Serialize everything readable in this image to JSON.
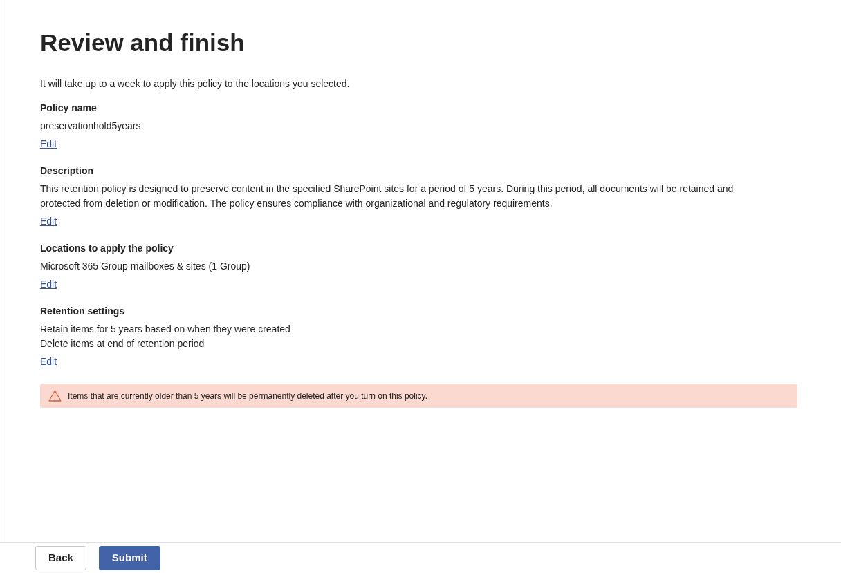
{
  "title": "Review and finish",
  "intro": "It will take up to a week to apply this policy to the locations you selected.",
  "sections": [
    {
      "heading": "Policy name",
      "lines": [
        "preservationhold5years"
      ],
      "link": "Edit"
    },
    {
      "heading": "Description",
      "lines": [
        "This retention policy is designed to preserve content in the specified SharePoint sites for a period of 5 years. During this period, all documents will be retained and protected from deletion or modification. The policy ensures compliance with organizational and regulatory requirements."
      ],
      "link": "Edit"
    },
    {
      "heading": "Locations to apply the policy",
      "lines": [
        "Microsoft 365 Group mailboxes & sites (1 Group)"
      ],
      "link": "Edit"
    },
    {
      "heading": "Retention settings",
      "lines": [
        "Retain items for 5 years based on when they were created",
        "Delete items at end of retention period"
      ],
      "link": "Edit"
    }
  ],
  "warning": {
    "text": "Items that are currently older than 5 years will be permanently deleted after you turn on this policy."
  },
  "buttons": [
    {
      "label": "Back",
      "kind": "secondary"
    },
    {
      "label": "Submit",
      "kind": "primary"
    }
  ]
}
